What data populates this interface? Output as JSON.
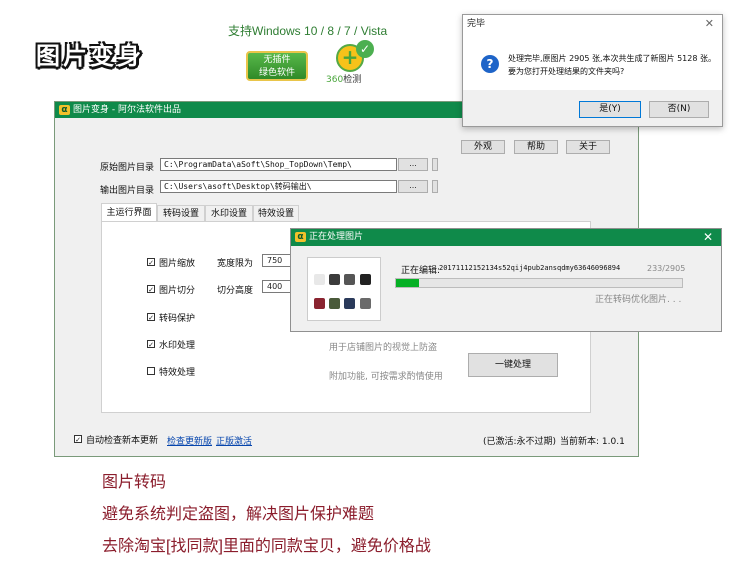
{
  "header": {
    "product_name": "图片变身",
    "support": "支持Windows 10 / 8 / 7 / Vista",
    "badge_green_line1": "无插件",
    "badge_green_line2": "绿色软件",
    "badge_360_number": "360",
    "badge_360_text": "检测"
  },
  "main_window": {
    "title": "图片变身 - 阿尔法软件出品",
    "buttons": {
      "appearance": "外观",
      "help": "帮助",
      "about": "关于"
    },
    "source_dir_label": "原始图片目录",
    "source_dir_value": "C:\\ProgramData\\aSoft\\Shop_TopDown\\Temp\\",
    "output_dir_label": "输出图片目录",
    "output_dir_value": "C:\\Users\\asoft\\Desktop\\转码输出\\",
    "browse": "...",
    "tabs": [
      "主运行界面",
      "转码设置",
      "水印设置",
      "特效设置"
    ],
    "options": {
      "resize": "图片缩放",
      "width_label": "宽度限为",
      "width_value": "750",
      "split": "图片切分",
      "split_height_label": "切分高度",
      "split_height_value": "400",
      "transcode_protect": "转码保护",
      "watermark": "水印处理",
      "watermark_desc": "用于店铺图片的视觉上防盗",
      "effects": "特效处理",
      "effects_desc": "附加功能, 可按需求酌情使用"
    },
    "process_button": "一键处理",
    "auto_update": "自动检查新本更新",
    "check_update": "检查更新版",
    "official_activate": "正版激活",
    "status": "(已激活:永不过期)",
    "version": "当前新本: 1.0.1"
  },
  "progress_window": {
    "title": "正在处理图片",
    "editing_label": "正在编辑:",
    "editing_file": "20171112152134s52qij4pub2ansqdmy63646096894",
    "count": "233/2905",
    "progress": 0.08,
    "status": "正在转码优化图片. . ."
  },
  "dialog": {
    "title": "完毕",
    "message_line1": "处理完毕,原图片 2905 张,本次共生成了新图片 5128 张。",
    "message_line2": "要为您打开处理结果的文件夹吗?",
    "yes": "是(Y)",
    "no": "否(N)"
  },
  "captions": {
    "line1": "图片转码",
    "line2": "避免系统判定盗图，解决图片保护难题",
    "line3": "去除淘宝[找同款]里面的同款宝贝，避免价格战"
  },
  "colors": {
    "accent_green": "#0f8a4a",
    "caption_red": "#8b1d2c",
    "progress_green": "#06b025"
  }
}
